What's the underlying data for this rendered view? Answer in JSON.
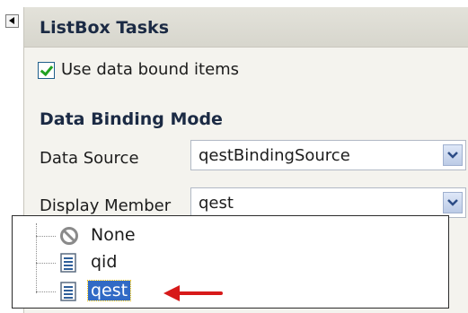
{
  "panel": {
    "title": "ListBox Tasks",
    "use_data_bound": {
      "label": "Use data bound items",
      "checked": true
    },
    "section_title": "Data Binding Mode",
    "fields": [
      {
        "label": "Data Source",
        "value": "qestBindingSource"
      },
      {
        "label": "Display Member",
        "value": "qest"
      }
    ]
  },
  "dropdown": {
    "items": [
      {
        "label": "None",
        "icon": "none-icon"
      },
      {
        "label": "qid",
        "icon": "field-icon"
      },
      {
        "label": "qest",
        "icon": "field-icon",
        "selected": true
      }
    ]
  },
  "colors": {
    "panel_bg": "#f4f3ee",
    "header_bg": "#dcdbd2",
    "selection": "#316ac5",
    "arrow": "#d71a1a",
    "check": "#21a121"
  }
}
